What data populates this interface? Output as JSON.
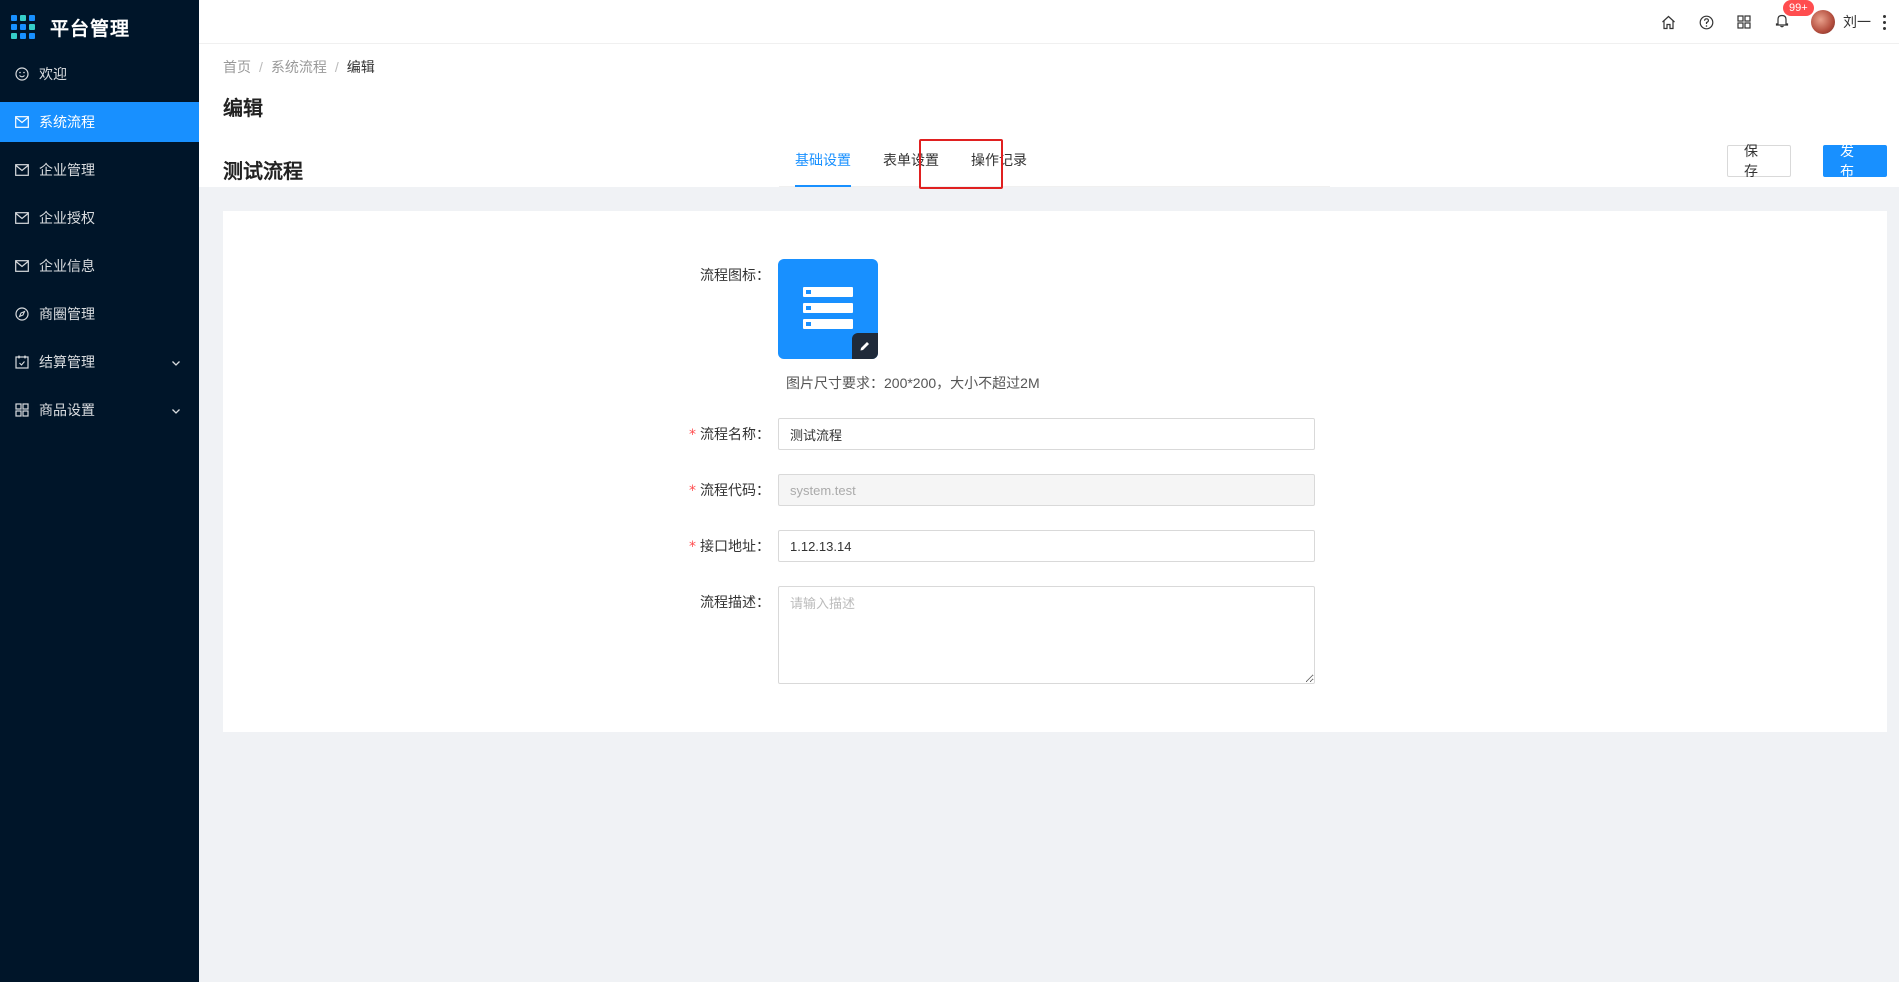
{
  "app": {
    "title": "平台管理"
  },
  "sidebar": {
    "items": [
      {
        "label": "欢迎",
        "icon": "smile-icon",
        "active": false
      },
      {
        "label": "系统流程",
        "icon": "mail-icon",
        "active": true
      },
      {
        "label": "企业管理",
        "icon": "mail-icon",
        "active": false
      },
      {
        "label": "企业授权",
        "icon": "mail-icon",
        "active": false
      },
      {
        "label": "企业信息",
        "icon": "mail-icon",
        "active": false
      },
      {
        "label": "商圈管理",
        "icon": "compass-icon",
        "active": false
      },
      {
        "label": "结算管理",
        "icon": "calendar-icon",
        "active": false,
        "expandable": true
      },
      {
        "label": "商品设置",
        "icon": "appstore-icon",
        "active": false,
        "expandable": true
      }
    ]
  },
  "header": {
    "notifications_badge": "99+",
    "user_name": "刘一"
  },
  "breadcrumb": {
    "home": "首页",
    "parent": "系统流程",
    "current": "编辑"
  },
  "page": {
    "title": "编辑",
    "flow_name": "测试流程",
    "tabs": [
      "基础设置",
      "表单设置",
      "操作记录"
    ],
    "active_tab": "基础设置",
    "save_label": "保存",
    "publish_label": "发布"
  },
  "form": {
    "icon_label": "流程图标：",
    "icon_hint": "图片尺寸要求：200*200，大小不超过2M",
    "name_label": "流程名称：",
    "name_value": "测试流程",
    "code_label": "流程代码：",
    "code_value": "system.test",
    "api_label": "接口地址：",
    "api_value": "1.12.13.14",
    "desc_label": "流程描述：",
    "desc_placeholder": "请输入描述",
    "required_mark": "*"
  },
  "colors": {
    "accent": "#1890ff",
    "sidebar_bg": "#001529",
    "highlight": "#e02020"
  }
}
